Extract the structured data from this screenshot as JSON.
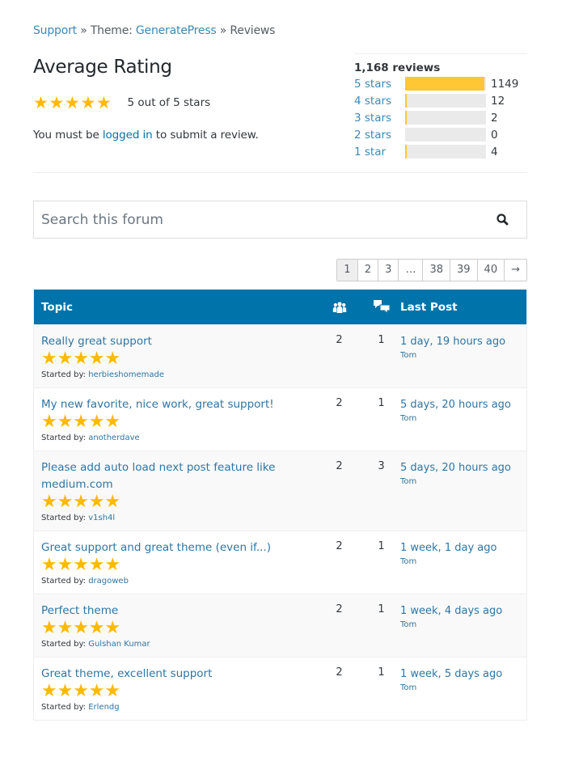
{
  "breadcrumb": {
    "items": [
      {
        "label": "Support",
        "link": true
      },
      {
        "label": " » Theme: ",
        "link": false
      },
      {
        "label": "GeneratePress",
        "link": true
      },
      {
        "label": " » Reviews",
        "link": false
      }
    ]
  },
  "rating": {
    "title": "Average Rating",
    "stars": 5,
    "text": "5 out of 5 stars",
    "login_prefix": "You must be ",
    "login_link": "logged in",
    "login_suffix": " to submit a review."
  },
  "counts": {
    "title": "1,168 reviews",
    "colors": {
      "fill": "#ffc733",
      "empty": "#eaeaea"
    },
    "rows": [
      {
        "label": "5 stars",
        "count": "1149",
        "fraction": 0.984
      },
      {
        "label": "4 stars",
        "count": "12",
        "fraction": 0.01
      },
      {
        "label": "3 stars",
        "count": "2",
        "fraction": 0.01
      },
      {
        "label": "2 stars",
        "count": "0",
        "fraction": 0
      },
      {
        "label": "1 star",
        "count": "4",
        "fraction": 0.01
      }
    ]
  },
  "search": {
    "placeholder": "Search this forum",
    "icon": "search-icon"
  },
  "pagination": {
    "pages": [
      "1",
      "2",
      "3",
      "…",
      "38",
      "39",
      "40",
      "→"
    ],
    "current": "1"
  },
  "table": {
    "header_color": "#0073aa",
    "columns": {
      "topic": "Topic",
      "voices_icon": "users-icon",
      "posts_icon": "speech-bubbles-icon",
      "last_post": "Last Post"
    },
    "started_by_label": "Started by: ",
    "rows": [
      {
        "title": "Really great support",
        "stars": 5,
        "author": "herbieshomemade",
        "voices": "2",
        "posts": "1",
        "last_time": "1 day, 19 hours ago",
        "last_author": "Tom"
      },
      {
        "title": "My new favorite, nice work, great support!",
        "stars": 5,
        "author": "anotherdave",
        "voices": "2",
        "posts": "1",
        "last_time": "5 days, 20 hours ago",
        "last_author": "Tom"
      },
      {
        "title": "Please add auto load next post feature like medium.com",
        "stars": 5,
        "author": "v1sh4l",
        "voices": "2",
        "posts": "3",
        "last_time": "5 days, 20 hours ago",
        "last_author": "Tom"
      },
      {
        "title": "Great support and great theme (even if...)",
        "stars": 5,
        "author": "dragoweb",
        "voices": "2",
        "posts": "1",
        "last_time": "1 week, 1 day ago",
        "last_author": "Tom"
      },
      {
        "title": "Perfect theme",
        "stars": 5,
        "author": "Gulshan Kumar",
        "voices": "2",
        "posts": "1",
        "last_time": "1 week, 4 days ago",
        "last_author": "Tom"
      },
      {
        "title": "Great theme, excellent support",
        "stars": 5,
        "author": "Erlendg",
        "voices": "2",
        "posts": "1",
        "last_time": "1 week, 5 days ago",
        "last_author": "Tom"
      }
    ]
  }
}
